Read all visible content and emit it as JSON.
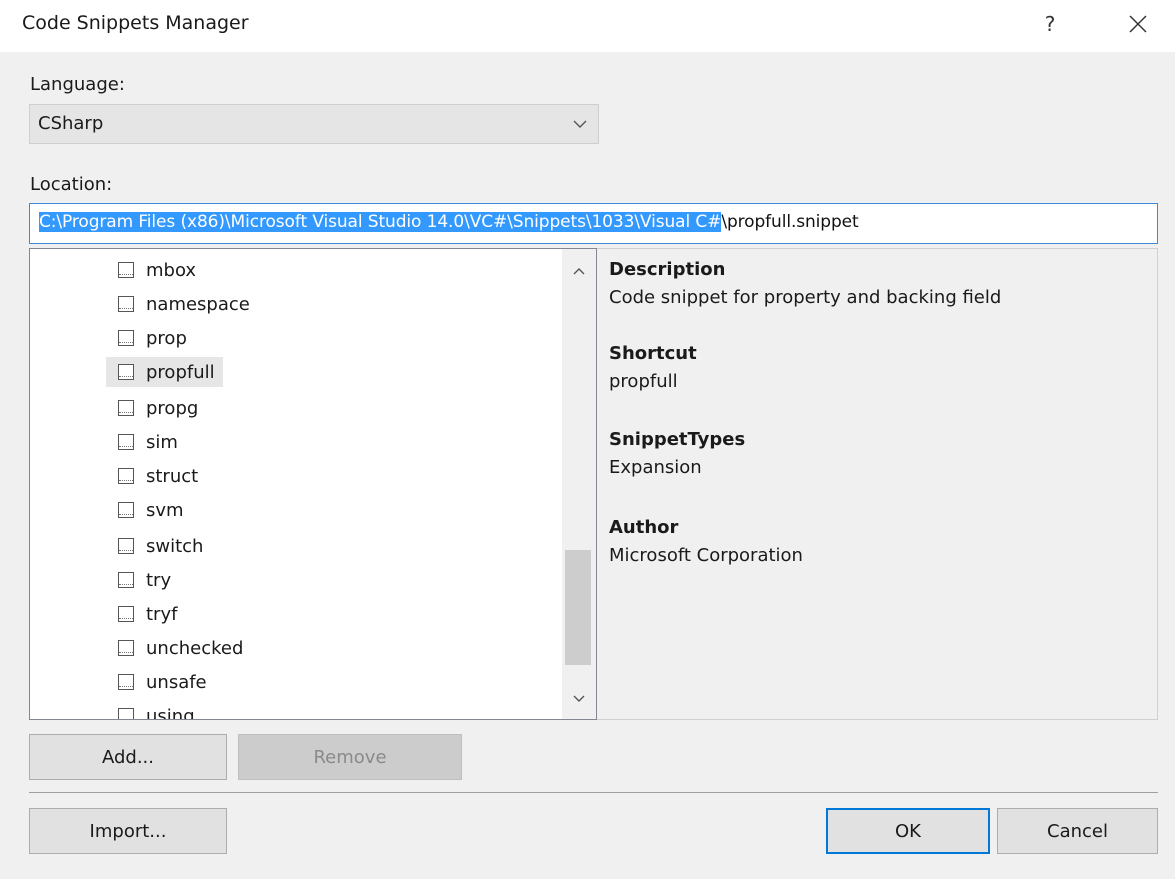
{
  "window": {
    "title": "Code Snippets Manager",
    "help_label": "?",
    "close_icon": "close-icon"
  },
  "language": {
    "label": "Language:",
    "selected": "CSharp"
  },
  "location": {
    "label": "Location:",
    "selected_part": "C:\\Program Files (x86)\\Microsoft Visual Studio 14.0\\VC#\\Snippets\\1033\\Visual C#",
    "rest_part": "\\propfull.snippet"
  },
  "snippets": {
    "items": [
      {
        "label": "mbox",
        "checked": false
      },
      {
        "label": "namespace",
        "checked": false
      },
      {
        "label": "prop",
        "checked": false
      },
      {
        "label": "propfull",
        "checked": false,
        "selected": true
      },
      {
        "label": "propg",
        "checked": false
      },
      {
        "label": "sim",
        "checked": false
      },
      {
        "label": "struct",
        "checked": false
      },
      {
        "label": "svm",
        "checked": false
      },
      {
        "label": "switch",
        "checked": false
      },
      {
        "label": "try",
        "checked": false
      },
      {
        "label": "tryf",
        "checked": false
      },
      {
        "label": "unchecked",
        "checked": false
      },
      {
        "label": "unsafe",
        "checked": false
      },
      {
        "label": "using",
        "checked": false
      }
    ]
  },
  "details": {
    "description_heading": "Description",
    "description_value": "Code snippet for property and backing field",
    "shortcut_heading": "Shortcut",
    "shortcut_value": "propfull",
    "types_heading": "SnippetTypes",
    "types_value": "Expansion",
    "author_heading": "Author",
    "author_value": "Microsoft Corporation"
  },
  "buttons": {
    "add": "Add...",
    "remove": "Remove",
    "import": "Import...",
    "ok": "OK",
    "cancel": "Cancel"
  },
  "colors": {
    "selection": "#3399ff",
    "default_button_border": "#0078d7"
  }
}
